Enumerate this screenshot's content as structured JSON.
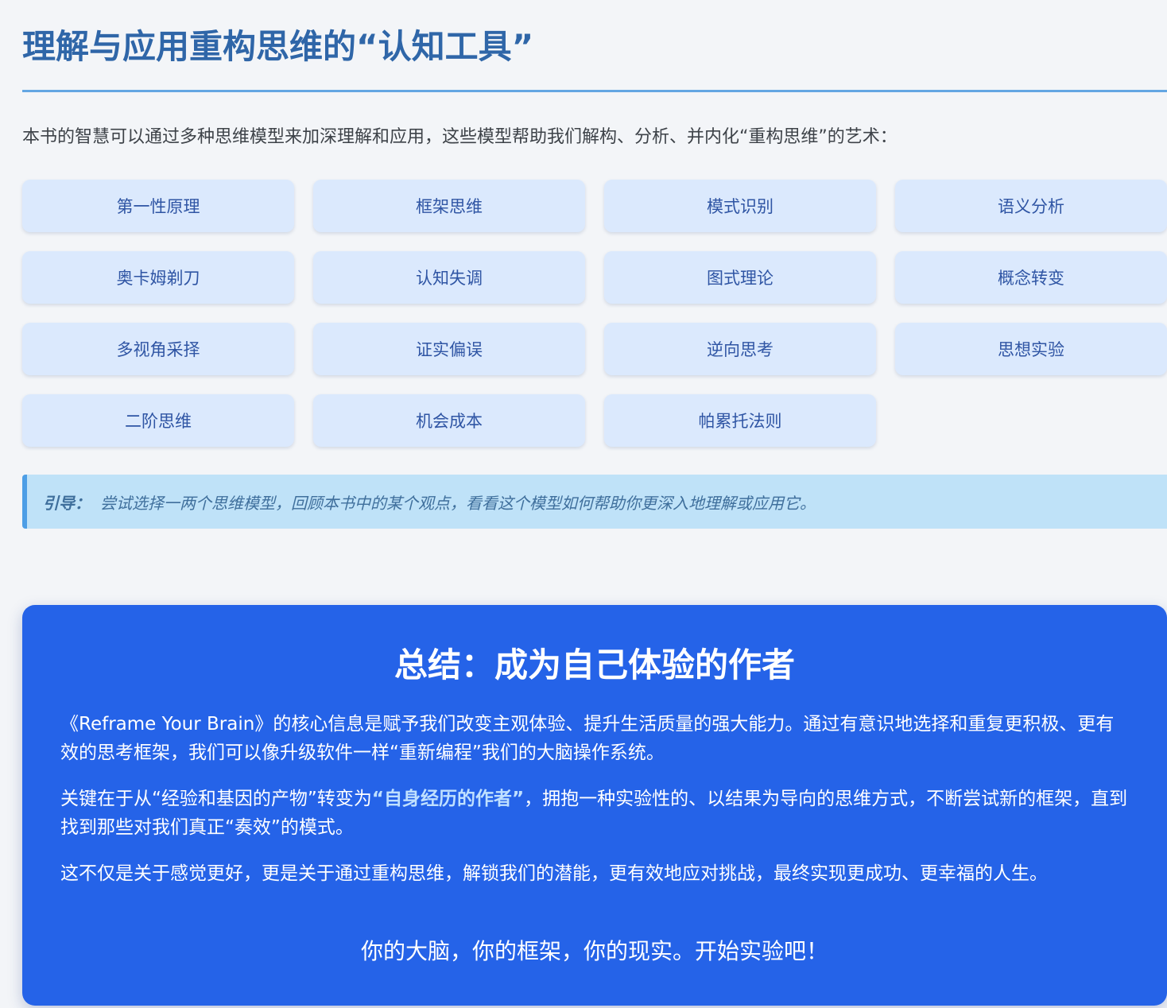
{
  "tools_section": {
    "title": "理解与应用重构思维的“认知工具”",
    "intro": "本书的智慧可以通过多种思维模型来加深理解和应用，这些模型帮助我们解构、分析、并内化“重构思维”的艺术：",
    "tools": [
      "第一性原理",
      "框架思维",
      "模式识别",
      "语义分析",
      "奥卡姆剃刀",
      "认知失调",
      "图式理论",
      "概念转变",
      "多视角采择",
      "证实偏误",
      "逆向思考",
      "思想实验",
      "二阶思维",
      "机会成本",
      "帕累托法则"
    ],
    "guide_label": "引导：",
    "guide_text": "尝试选择一两个思维模型，回顾本书中的某个观点，看看这个模型如何帮助你更深入地理解或应用它。"
  },
  "summary": {
    "title": "总结：成为自己体验的作者",
    "p1": "《Reframe Your Brain》的核心信息是赋予我们改变主观体验、提升生活质量的强大能力。通过有意识地选择和重复更积极、更有效的思考框架，我们可以像升级软件一样“重新编程”我们的大脑操作系统。",
    "p2_before": "关键在于从“经验和基因的产物”转变为",
    "p2_highlight": "“自身经历的作者”",
    "p2_after": "，拥抱一种实验性的、以结果为导向的思维方式，不断尝试新的框架，直到找到那些对我们真正“奏效”的模式。",
    "p3": "这不仅是关于感觉更好，更是关于通过重构思维，解锁我们的潜能，更有效地应对挑战，最终实现更成功、更幸福的人生。",
    "closing": "你的大脑，你的框架，你的现实。开始实验吧！"
  }
}
